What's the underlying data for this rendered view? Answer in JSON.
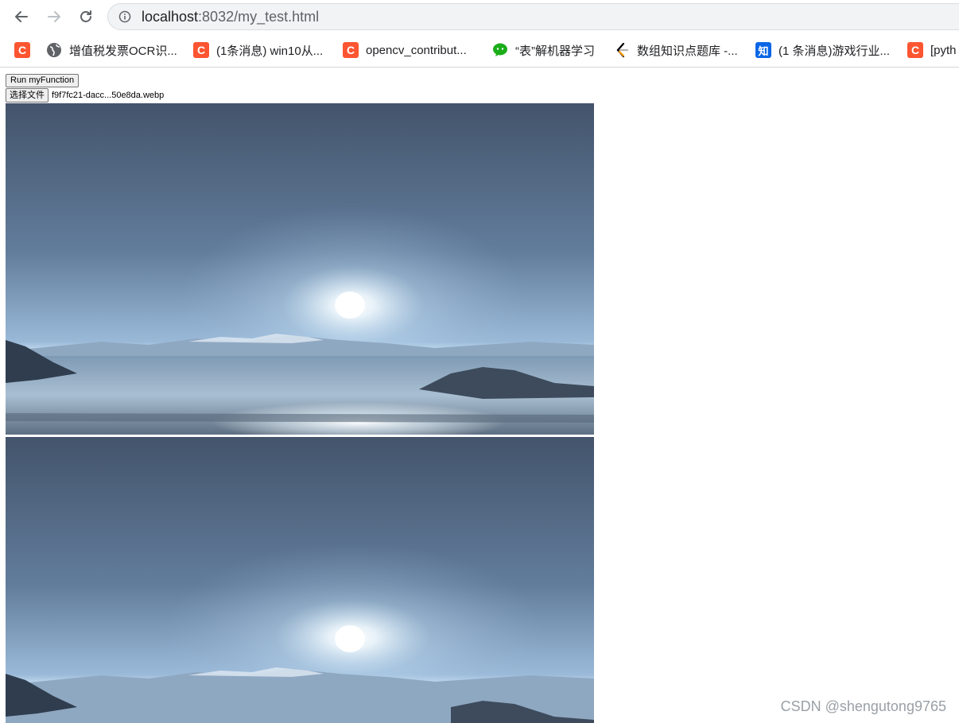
{
  "browser": {
    "url_host": "localhost",
    "url_path": ":8032/my_test.html",
    "bookmarks": [
      {
        "label": "",
        "icon": "csdn-icon"
      },
      {
        "label": "增值税发票OCR识...",
        "icon": "globe-icon"
      },
      {
        "label": "(1条消息) win10从...",
        "icon": "csdn-icon"
      },
      {
        "label": "opencv_contribut...",
        "icon": "csdn-icon"
      },
      {
        "label": "“表”解机器学习",
        "icon": "wechat-icon"
      },
      {
        "label": "数组知识点题库 -...",
        "icon": "leetcode-icon"
      },
      {
        "label": "(1 条消息)游戏行业...",
        "icon": "zhihu-icon"
      },
      {
        "label": "[pyth",
        "icon": "csdn-icon"
      }
    ],
    "csdn_glyph": "C",
    "zhihu_glyph": "知"
  },
  "page": {
    "run_button_label": "Run myFunction",
    "file_button_label": "选择文件",
    "file_name": "f9f7fc21-dacc...50e8da.webp"
  },
  "watermark": "CSDN @shengutong9765",
  "colors": {
    "csdn": "#fc5531",
    "zhihu": "#0a66e6",
    "wechat": "#1aad19",
    "sky_top": "#43546b",
    "sky_bottom": "#a9c9e4"
  }
}
